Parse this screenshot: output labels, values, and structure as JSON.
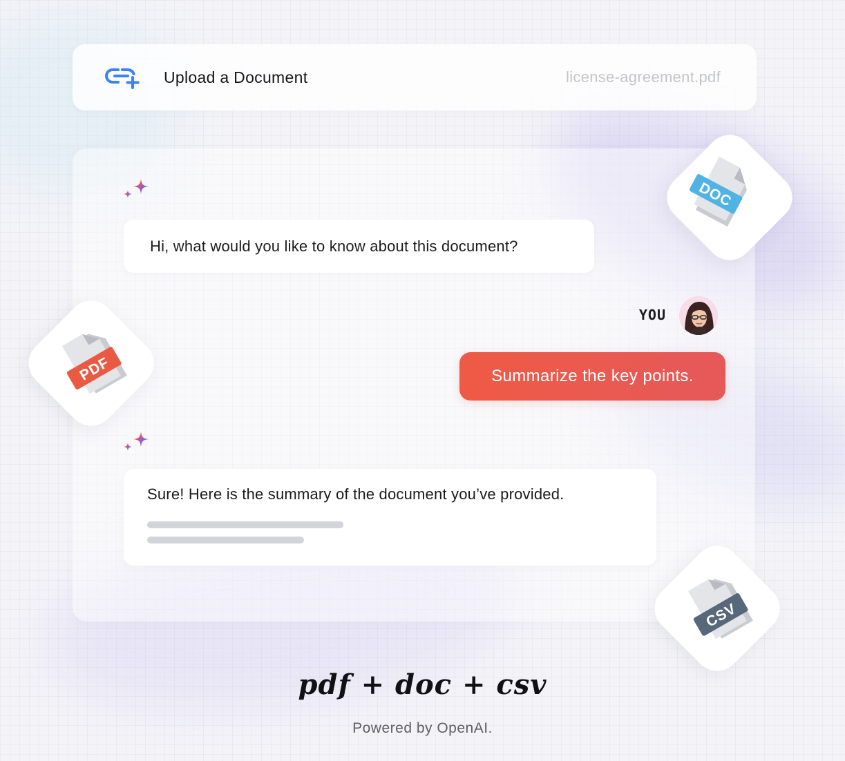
{
  "upload": {
    "title": "Upload a Document",
    "filename": "license-agreement.pdf"
  },
  "chat": {
    "assistant_greeting": "Hi, what would you like to know about this document?",
    "user_label": "YOU",
    "user_message": "Summarize the key points.",
    "assistant_reply": "Sure! Here is the summary of the document you’ve provided."
  },
  "file_badges": {
    "doc": "DOC",
    "pdf": "PDF",
    "csv": "CSV"
  },
  "footer": {
    "tagline": "pdf + doc + csv",
    "powered_by": "Powered by OpenAI."
  },
  "colors": {
    "accent_blue": "#3b82f6",
    "user_bubble": "#ef5a45",
    "doc_badge": "#4fb3e6",
    "pdf_badge": "#ea5a43",
    "csv_badge": "#56687a"
  },
  "icons": {
    "upload": "link-plus-icon",
    "assistant": "sparkle-icon",
    "avatar": "user-avatar"
  }
}
